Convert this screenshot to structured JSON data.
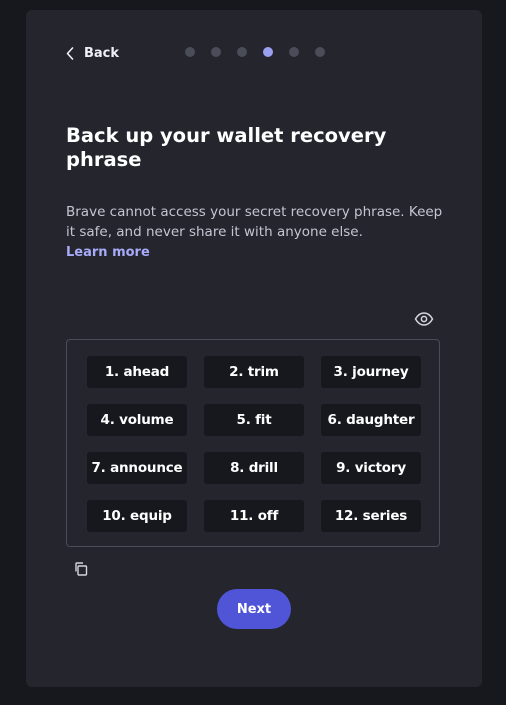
{
  "nav": {
    "back_label": "Back",
    "step_count": 6,
    "active_step": 4
  },
  "header": {
    "title": "Back up your wallet recovery phrase"
  },
  "body": {
    "description": "Brave cannot access your secret recovery phrase. Keep it safe, and never share it with anyone else.",
    "learn_more": "Learn more"
  },
  "phrase": {
    "words": [
      "1. ahead",
      "2. trim",
      "3. journey",
      "4. volume",
      "5. fit",
      "6. daughter",
      "7. announce",
      "8. drill",
      "9. victory",
      "10. equip",
      "11. off",
      "12. series"
    ]
  },
  "actions": {
    "next_label": "Next"
  },
  "icons": {
    "back": "chevron-left-icon",
    "reveal": "eye-icon",
    "copy": "copy-icon"
  },
  "colors": {
    "background": "#17181e",
    "card": "#24252d",
    "accent": "#4f55d6",
    "link": "#a7abf9",
    "active_dot": "#9aa0f0"
  }
}
